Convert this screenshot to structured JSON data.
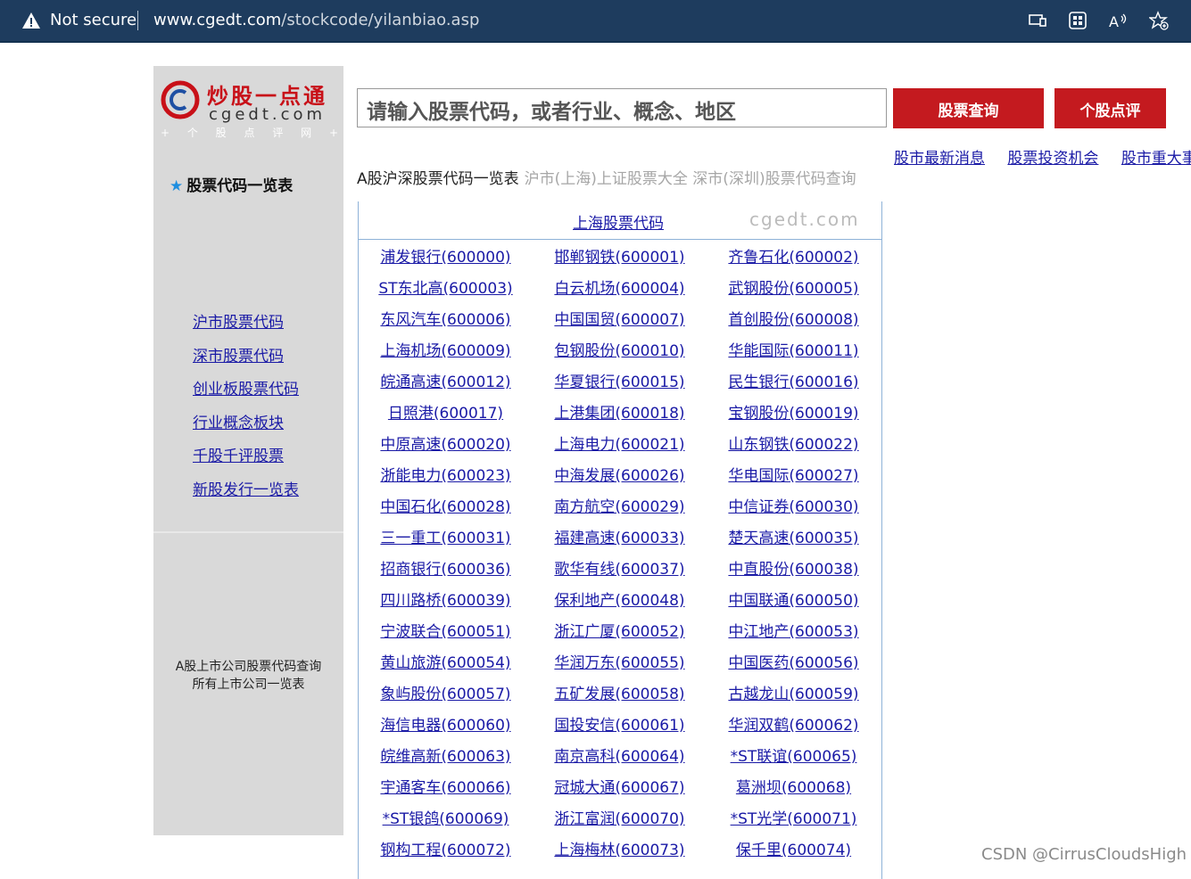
{
  "browser": {
    "security_label": "Not secure",
    "url_host": "www.cgedt.com",
    "url_path": "/stockcode/yilanbiao.asp",
    "icons": [
      "read-view-icon",
      "apps-icon",
      "read-aloud-icon",
      "favorites-add-icon"
    ]
  },
  "logo": {
    "cn": "炒股一点通",
    "en": "cgedt.com",
    "tagline": "+ 个 股 点 评 网 +"
  },
  "sidebar": {
    "title": "股票代码一览表",
    "links": [
      "沪市股票代码",
      "深市股票代码",
      "创业板股票代码",
      "行业概念板块",
      "千股千评股票",
      "新股发行一览表"
    ],
    "note_line1": "A股上市公司股票代码查询",
    "note_line2": "所有上市公司一览表"
  },
  "search": {
    "placeholder": "请输入股票代码，或者行业、概念、地区",
    "btn_query": "股票查询",
    "btn_review": "个股点评"
  },
  "right_links": [
    "股市最新消息",
    "股票投资机会",
    "股市重大事"
  ],
  "crumb": {
    "main": "A股沪深股票代码一览表",
    "sub": "沪市(上海)上证股票大全 深市(深圳)股票代码查询"
  },
  "table": {
    "title": "上海股票代码",
    "watermark": "cgedt.com",
    "rows": [
      [
        "浦发银行(600000)",
        "邯郸钢铁(600001)",
        "齐鲁石化(600002)"
      ],
      [
        "ST东北高(600003)",
        "白云机场(600004)",
        "武钢股份(600005)"
      ],
      [
        "东风汽车(600006)",
        "中国国贸(600007)",
        "首创股份(600008)"
      ],
      [
        "上海机场(600009)",
        "包钢股份(600010)",
        "华能国际(600011)"
      ],
      [
        "皖通高速(600012)",
        "华夏银行(600015)",
        "民生银行(600016)"
      ],
      [
        "日照港(600017)",
        "上港集团(600018)",
        "宝钢股份(600019)"
      ],
      [
        "中原高速(600020)",
        "上海电力(600021)",
        "山东钢铁(600022)"
      ],
      [
        "浙能电力(600023)",
        "中海发展(600026)",
        "华电国际(600027)"
      ],
      [
        "中国石化(600028)",
        "南方航空(600029)",
        "中信证券(600030)"
      ],
      [
        "三一重工(600031)",
        "福建高速(600033)",
        "楚天高速(600035)"
      ],
      [
        "招商银行(600036)",
        "歌华有线(600037)",
        "中直股份(600038)"
      ],
      [
        "四川路桥(600039)",
        "保利地产(600048)",
        "中国联通(600050)"
      ],
      [
        "宁波联合(600051)",
        "浙江广厦(600052)",
        "中江地产(600053)"
      ],
      [
        "黄山旅游(600054)",
        "华润万东(600055)",
        "中国医药(600056)"
      ],
      [
        "象屿股份(600057)",
        "五矿发展(600058)",
        "古越龙山(600059)"
      ],
      [
        "海信电器(600060)",
        "国投安信(600061)",
        "华润双鹤(600062)"
      ],
      [
        "皖维高新(600063)",
        "南京高科(600064)",
        "*ST联谊(600065)"
      ],
      [
        "宇通客车(600066)",
        "冠城大通(600067)",
        "葛洲坝(600068)"
      ],
      [
        "*ST银鸽(600069)",
        "浙江富润(600070)",
        "*ST光学(600071)"
      ],
      [
        "钢构工程(600072)",
        "上海梅林(600073)",
        "保千里(600074)"
      ]
    ]
  },
  "footer_watermark": "CSDN @CirrusCloudsHigh"
}
